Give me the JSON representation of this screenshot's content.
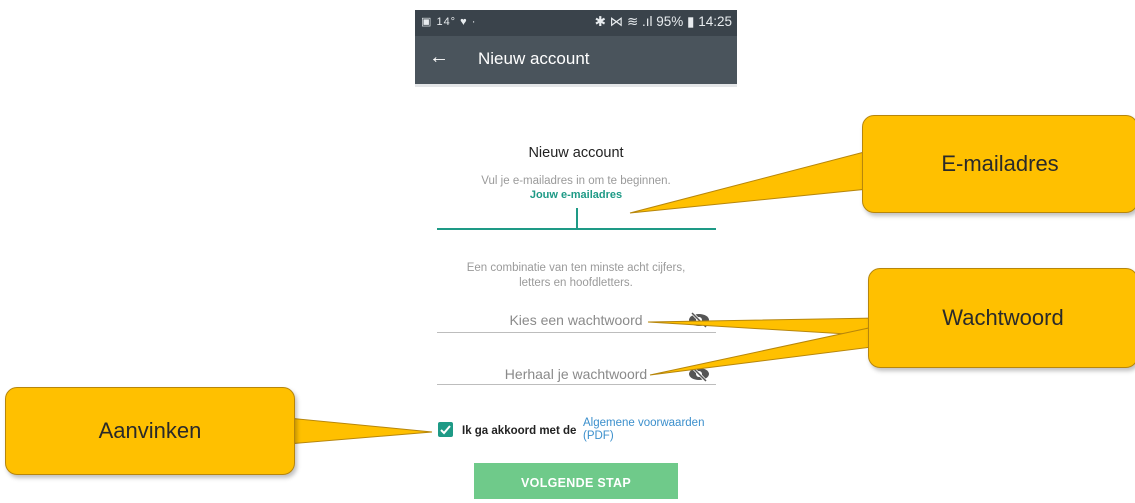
{
  "status_bar": {
    "left_icons": "▣ 14° ♥ ·",
    "right_text": "✱ ⋈ ≋ .ıl 95% ▮ 14:25"
  },
  "app_bar": {
    "back_icon": "arrow-left-icon",
    "title": "Nieuw account"
  },
  "form": {
    "title": "Nieuw account",
    "subtitle": "Vul je e‑mailadres in om te beginnen.",
    "email": {
      "label": "Jouw e‑mailadres",
      "value": ""
    },
    "password_hint_line1": "Een combinatie van ten minste acht cijfers,",
    "password_hint_line2": "letters en hoofdletters.",
    "password": {
      "placeholder": "Kies een wachtwoord",
      "visibility_icon": "eye-off-icon"
    },
    "password_repeat": {
      "placeholder": "Herhaal je wachtwoord",
      "visibility_icon": "eye-off-icon"
    },
    "agree": {
      "checked": true,
      "text": "Ik ga akkoord met de",
      "link_line1": "Algemene voorwaarden",
      "link_line2": "(PDF)"
    },
    "next_button": "VOLGENDE STAP"
  },
  "callouts": {
    "email": "E-mailadres",
    "password": "Wachtwoord",
    "checkbox": "Aanvinken"
  },
  "colors": {
    "status_bar": "#3a434b",
    "app_bar": "#4a545c",
    "accent": "#1e9a86",
    "link": "#3b8fcc",
    "button": "#6fca8a",
    "callout": "#ffc000"
  }
}
